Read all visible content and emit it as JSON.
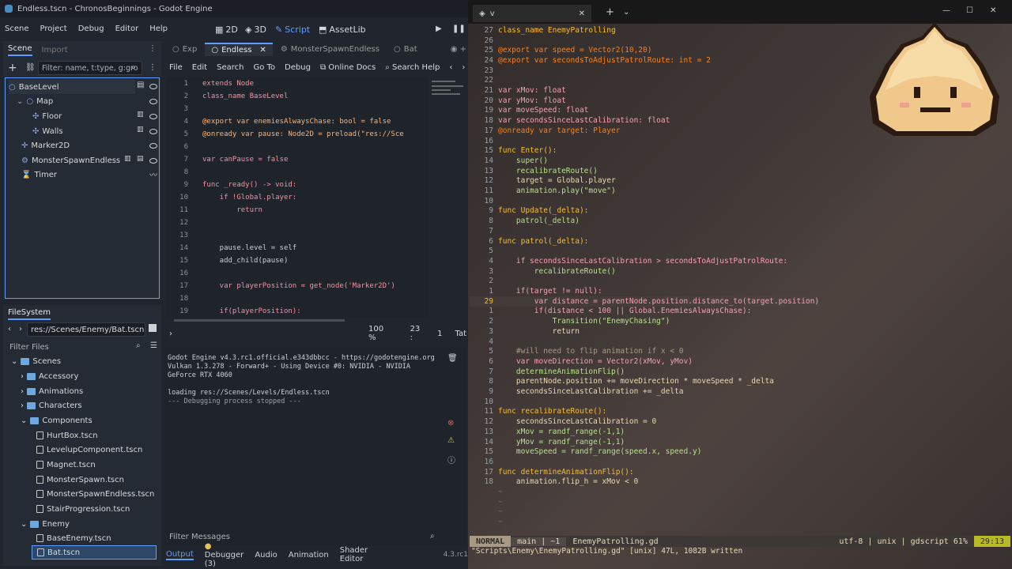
{
  "window": {
    "title": "Endless.tscn - ChronosBeginnings - Godot Engine"
  },
  "menus": [
    "Scene",
    "Project",
    "Debug",
    "Editor",
    "Help"
  ],
  "workspaces": [
    {
      "label": "2D",
      "active": false
    },
    {
      "label": "3D",
      "active": false
    },
    {
      "label": "Script",
      "active": true
    },
    {
      "label": "AssetLib",
      "active": false
    }
  ],
  "scene_dock": {
    "tabs": [
      "Scene",
      "Import"
    ],
    "filter_placeholder": "Filter: name, t:type, g:gro",
    "nodes": [
      {
        "label": "BaseLevel",
        "depth": 0
      },
      {
        "label": "Map",
        "depth": 1
      },
      {
        "label": "Floor",
        "depth": 2
      },
      {
        "label": "Walls",
        "depth": 2
      },
      {
        "label": "Marker2D",
        "depth": 1
      },
      {
        "label": "MonsterSpawnEndless",
        "depth": 1
      },
      {
        "label": "Timer",
        "depth": 1
      }
    ]
  },
  "filesystem": {
    "title": "FileSystem",
    "path": "res://Scenes/Enemy/Bat.tscn",
    "filter_placeholder": "Filter Files",
    "items": [
      {
        "label": "Scenes",
        "kind": "folder",
        "depth": 0
      },
      {
        "label": "Accessory",
        "kind": "folder",
        "depth": 1
      },
      {
        "label": "Animations",
        "kind": "folder",
        "depth": 1
      },
      {
        "label": "Characters",
        "kind": "folder",
        "depth": 1
      },
      {
        "label": "Components",
        "kind": "folder",
        "depth": 1
      },
      {
        "label": "HurtBox.tscn",
        "kind": "file",
        "depth": 2
      },
      {
        "label": "LevelupComponent.tscn",
        "kind": "file",
        "depth": 2
      },
      {
        "label": "Magnet.tscn",
        "kind": "file",
        "depth": 2
      },
      {
        "label": "MonsterSpawn.tscn",
        "kind": "file",
        "depth": 2
      },
      {
        "label": "MonsterSpawnEndless.tscn",
        "kind": "file",
        "depth": 2
      },
      {
        "label": "StairProgression.tscn",
        "kind": "file",
        "depth": 2
      },
      {
        "label": "Enemy",
        "kind": "folder",
        "depth": 1
      },
      {
        "label": "BaseEnemy.tscn",
        "kind": "file",
        "depth": 2
      },
      {
        "label": "Bat.tscn",
        "kind": "file",
        "depth": 2
      }
    ]
  },
  "scene_tabs": [
    "Exp",
    "Endless",
    "MonsterSpawnEndless",
    "Bat"
  ],
  "script_menu": [
    "File",
    "Edit",
    "Search",
    "Go To",
    "Debug",
    "Online Docs",
    "Search Help"
  ],
  "gd_code": [
    {
      "n": "1",
      "t": "extends Node"
    },
    {
      "n": "2",
      "t": "class_name BaseLevel"
    },
    {
      "n": "3",
      "t": ""
    },
    {
      "n": "4",
      "t": "@export var enemiesAlwaysChase: bool = false"
    },
    {
      "n": "5",
      "t": "@onready var pause: Node2D = preload(\"res://Sce"
    },
    {
      "n": "6",
      "t": ""
    },
    {
      "n": "7",
      "t": "var canPause = false"
    },
    {
      "n": "8",
      "t": ""
    },
    {
      "n": "9",
      "t": "func _ready() -> void:"
    },
    {
      "n": "10",
      "t": "    if !Global.player:"
    },
    {
      "n": "11",
      "t": "        return"
    },
    {
      "n": "12",
      "t": ""
    },
    {
      "n": "13",
      "t": ""
    },
    {
      "n": "14",
      "t": "    pause.level = self"
    },
    {
      "n": "15",
      "t": "    add_child(pause)"
    },
    {
      "n": "16",
      "t": ""
    },
    {
      "n": "17",
      "t": "    var playerPosition = get_node('Marker2D')"
    },
    {
      "n": "18",
      "t": ""
    },
    {
      "n": "19",
      "t": "    if(playerPosition):"
    }
  ],
  "editor_status": {
    "zoom": "100 %",
    "line": "23 :",
    "col": "1",
    "tab": "Tat"
  },
  "output": {
    "lines": [
      "Godot Engine v4.3.rc1.official.e343dbbcc - https://godotengine.org",
      "Vulkan 1.3.278 - Forward+ - Using Device #0: NVIDIA - NVIDIA",
      "GeForce RTX 4060",
      "",
      "loading res://Scenes/Levels/Endless.tscn",
      "--- Debugging process stopped ---"
    ],
    "filter_placeholder": "Filter Messages"
  },
  "bottom_tabs": [
    "Output",
    "Debugger (3)",
    "Audio",
    "Animation",
    "Shader Editor"
  ],
  "version": "4.3.rc1",
  "terminal": {
    "tab_title": "v"
  },
  "vim": {
    "lines": [
      {
        "n": "27",
        "t": "class_name EnemyPatrolling"
      },
      {
        "n": "26",
        "t": ""
      },
      {
        "n": "25",
        "t": "@export var speed = Vector2(10,20)"
      },
      {
        "n": "24",
        "t": "@export var secondsToAdjustPatrolRoute: int = 2"
      },
      {
        "n": "23",
        "t": ""
      },
      {
        "n": "22",
        "t": ""
      },
      {
        "n": "21",
        "t": "var xMov: float"
      },
      {
        "n": "20",
        "t": "var yMov: float"
      },
      {
        "n": "19",
        "t": "var moveSpeed: float"
      },
      {
        "n": "18",
        "t": "var secondsSinceLastCalibration: float"
      },
      {
        "n": "17",
        "t": "@onready var target: Player"
      },
      {
        "n": "16",
        "t": ""
      },
      {
        "n": "15",
        "t": "func Enter():"
      },
      {
        "n": "14",
        "t": "    super()"
      },
      {
        "n": "13",
        "t": "    recalibrateRoute()"
      },
      {
        "n": "12",
        "t": "    target = Global.player"
      },
      {
        "n": "11",
        "t": "    animation.play(\"move\")"
      },
      {
        "n": "10",
        "t": ""
      },
      {
        "n": "9",
        "t": "func Update(_delta):"
      },
      {
        "n": "8",
        "t": "    patrol(_delta)"
      },
      {
        "n": "7",
        "t": ""
      },
      {
        "n": "6",
        "t": "func patrol(_delta):"
      },
      {
        "n": "5",
        "t": ""
      },
      {
        "n": "4",
        "t": "    if secondsSinceLastCalibration > secondsToAdjustPatrolRoute:"
      },
      {
        "n": "3",
        "t": "        recalibrateRoute()"
      },
      {
        "n": "2",
        "t": ""
      },
      {
        "n": "1",
        "t": "    if(target != null):"
      },
      {
        "n": "29",
        "t": "        var distance = parentNode.position.distance_to(target.position)"
      },
      {
        "n": "1",
        "t": "        if(distance < 100 || Global.EnemiesAlwaysChase):"
      },
      {
        "n": "2",
        "t": "            Transition(\"EnemyChasing\")"
      },
      {
        "n": "3",
        "t": "            return"
      },
      {
        "n": "4",
        "t": ""
      },
      {
        "n": "5",
        "t": "    #will need to flip animation if x < 0"
      },
      {
        "n": "6",
        "t": "    var moveDirection = Vector2(xMov, yMov)"
      },
      {
        "n": "7",
        "t": "    determineAnimationFlip()"
      },
      {
        "n": "8",
        "t": "    parentNode.position += moveDirection * moveSpeed * _delta"
      },
      {
        "n": "9",
        "t": "    secondsSinceLastCalibration += _delta"
      },
      {
        "n": "10",
        "t": ""
      },
      {
        "n": "11",
        "t": "func recalibrateRoute():"
      },
      {
        "n": "12",
        "t": "    secondsSinceLastCalibration = 0"
      },
      {
        "n": "13",
        "t": "    xMov = randf_range(-1,1)"
      },
      {
        "n": "14",
        "t": "    yMov = randf_range(-1,1)"
      },
      {
        "n": "15",
        "t": "    moveSpeed = randf_range(speed.x, speed.y)"
      },
      {
        "n": "16",
        "t": ""
      },
      {
        "n": "17",
        "t": "func determineAnimationFlip():"
      },
      {
        "n": "18",
        "t": "    animation.flip_h = xMov < 0"
      },
      {
        "n": "",
        "t": "~"
      },
      {
        "n": "",
        "t": "~"
      },
      {
        "n": "",
        "t": "~"
      },
      {
        "n": "",
        "t": "~"
      }
    ],
    "mode": "NORMAL",
    "branch": "main | ~1",
    "filename": "EnemyPatrolling.gd",
    "right": "utf-8 | unix | gdscript  61%",
    "pos": "29:13",
    "message": "\"Scripts\\Enemy\\EnemyPatrolling.gd\" [unix] 47L, 1082B written"
  },
  "colors": {
    "accent": "#5f9eff",
    "vim_mode_bg": "#a89984",
    "vim_pos_bg": "#b8bb26"
  }
}
